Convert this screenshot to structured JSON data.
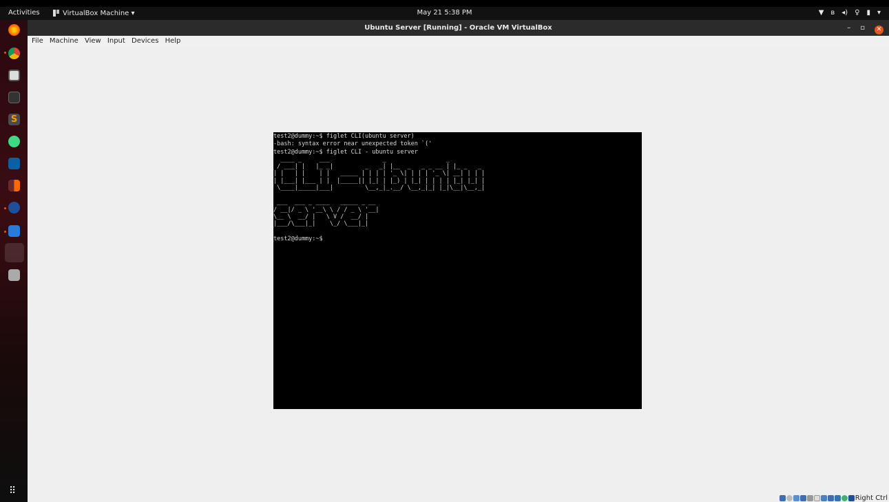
{
  "topbar": {
    "activities": "Activities",
    "app_menu": "VirtualBox Machine ▾",
    "clock": "May 21  5:38 PM",
    "tray": [
      "wifi-icon",
      "bluetooth-icon",
      "volume-icon",
      "mic-icon",
      "battery-icon",
      "chevron-down-icon"
    ]
  },
  "dock": {
    "items": [
      "firefox-icon",
      "chrome-icon",
      "files-icon",
      "terminal-icon",
      "sublime-icon",
      "android-studio-icon",
      "matlab-icon",
      "app-icon",
      "virtualbox-icon",
      "writer-icon",
      "active-window-icon",
      "disk-icon"
    ],
    "show_apps": "⠿"
  },
  "window": {
    "title": "Ubuntu Server [Running] - Oracle VM VirtualBox",
    "controls": {
      "minimize": "–",
      "restore": "▫",
      "close": "✕"
    }
  },
  "menubar": {
    "items": [
      "File",
      "Machine",
      "View",
      "Input",
      "Devices",
      "Help"
    ]
  },
  "terminal": {
    "lines": [
      "test2@dummy:~$ figlet CLI(ubuntu server)",
      "-bash: syntax error near unexpected token `('",
      "test2@dummy:~$ figlet CLI - ubuntu server"
    ],
    "figlet1": "  ____ _     ___               _                 _         \n / ___| |   |_ _|         _   _| |__  _   _ _ __ | |_ _   _ \n| |   | |    | |   _____ | | | | '_ \\| | | | '_ \\| __| | | |\n| |___| |___ | |  |_____|| |_| | |_) | |_| | | | | |_| |_| |\n \\____|_____|___|         \\__,_|_.__/ \\__,_|_| |_|\\__|\\__,_|",
    "figlet2": " ___  ___ _ ____   _____ _ __ \n/ __|/ _ \\ '__\\ \\ / / _ \\ '__|\n\\__ \\  __/ |   \\ V /  __/ |   \n|___/\\___|_|    \\_/ \\___|_|   ",
    "prompt": "test2@dummy:~$"
  },
  "status": {
    "host_key": "Right Ctrl"
  }
}
